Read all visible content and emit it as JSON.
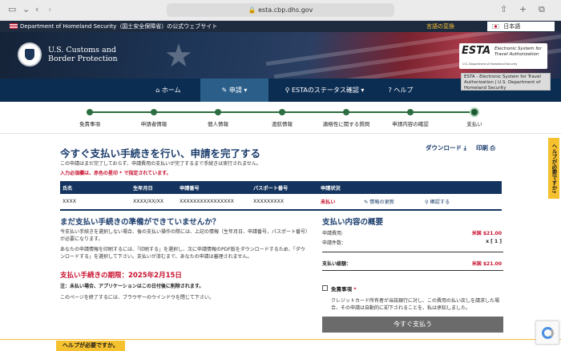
{
  "browser": {
    "url": "esta.cbp.dhs.gov"
  },
  "gov_banner": {
    "text": "Department of Homeland Security（国土安全保障省）の公式ウェブサイト",
    "lang_toggle": "言語の変換",
    "lang": "日本語"
  },
  "header": {
    "cbp_line1": "U.S. Customs and",
    "cbp_line2": "Border Protection",
    "esta_logo": "ESTA",
    "esta_title1": "Electronic System for",
    "esta_title2": "Travel Authorization",
    "esta_sub": "U.S. Department of Homeland Security",
    "tooltip": "ESTA - Electronic System for Travel Authorization | U.S. Department of Homeland Security"
  },
  "nav": {
    "home": "ホーム",
    "apply": "申請",
    "status": "ESTAのステータス確認",
    "help": "ヘルプ"
  },
  "steps": [
    "免責事項",
    "申請者情報",
    "個人情報",
    "渡航情報",
    "適格性に関する質問",
    "申請内容の確認",
    "支払い"
  ],
  "main": {
    "title": "今すぐ支払い手続きを行い、申請を完了する",
    "subtitle": "この申請はまだ完了しておらず、申請費用の支払いが完了するまで手続きは実行されません。",
    "required_note": "入力必須欄は、赤色の星印 * で指定されています。",
    "download": "ダウンロード",
    "print": "印刷"
  },
  "table": {
    "headers": [
      "氏名",
      "生年月日",
      "申請番号",
      "パスポート番号",
      "申請状況",
      "",
      ""
    ],
    "row": [
      "XXXX",
      "XXXX/XX/XX",
      "XXXXXXXXXXXXXXXX",
      "XXXXXXXXX",
      "未払い",
      "情報の更新",
      "確認する"
    ]
  },
  "left": {
    "heading": "まだ支払い手続きの準備ができていませんか？",
    "p1": "今支払い手続きを選択しない場合、後の支払い操作の際には、上記の情報（生年月日、申請番号、パスポート番号）が必要になります。",
    "p2": "あなたの申請情報を印刷するには、「印刷する」を選択し、次に申請情報のPDF版をダウンロードするため、「ダウンロードする」を選択して下さい。支払いが済むまで、あなたの申請は審理されません。",
    "deadline_label": "支払い手続きの期限：",
    "deadline": "2025年2月15日",
    "note": "注：未払い場合、アプリケーションはこの日付後に削除されます。",
    "close": "このページを終了するには、ブラウザーのウインドウを閉じて下さい。"
  },
  "summary": {
    "heading": "支払い内容の概要",
    "fee_label": "申請費用:",
    "fee": "米国 $21.00",
    "count_label": "申請件数：",
    "count": "x [ 1 ]",
    "total_label": "支払い総額：",
    "total": "米国 $21.00",
    "disclaimer": "免責事項",
    "disclaimer_text": "クレジットカード所有者が当該銀行に対し、この費用の払い戻しを請求した場合、その申請は自動的に却下されることを、私は承知しました。",
    "pay_button": "今すぐ支払う"
  },
  "help": {
    "side": "ヘルプが必要ですか",
    "bottom": "ヘルプが必要ですか。"
  },
  "colors": {
    "navy": "#0c2d52",
    "accent_yellow": "#f6c12f",
    "red": "#c8102e",
    "step_green": "#2c6e3f"
  }
}
